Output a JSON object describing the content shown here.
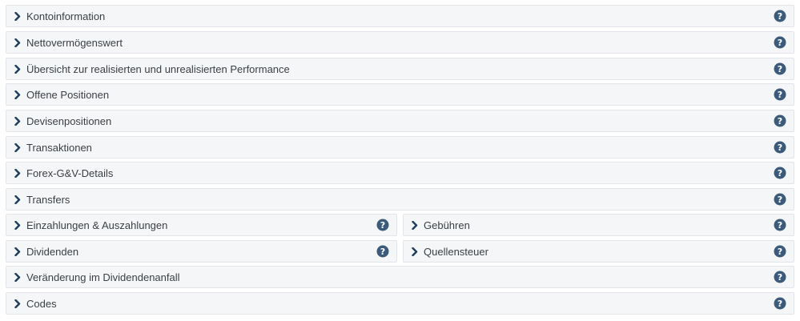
{
  "colors": {
    "panel_bg": "#f5f6f7",
    "panel_border": "#e3e5e8",
    "chevron": "#1f3d5c",
    "help_icon": "#3c5a7a",
    "text": "#3a3f45"
  },
  "icons": {
    "expand": "chevron-right-icon",
    "help": "question-circle-icon"
  },
  "sections": {
    "kontoinformation": "Kontoinformation",
    "nettovermoegenswert": "Nettovermögenswert",
    "performance": "Übersicht zur realisierten und unrealisierten Performance",
    "offene_positionen": "Offene Positionen",
    "devisenpositionen": "Devisenpositionen",
    "transaktionen": "Transaktionen",
    "forex_details": "Forex-G&V-Details",
    "transfers": "Transfers",
    "einzahlungen": "Einzahlungen & Auszahlungen",
    "gebuehren": "Gebühren",
    "dividenden": "Dividenden",
    "quellensteuer": "Quellensteuer",
    "dividendenanfall": "Veränderung im Dividendenanfall",
    "codes": "Codes"
  }
}
